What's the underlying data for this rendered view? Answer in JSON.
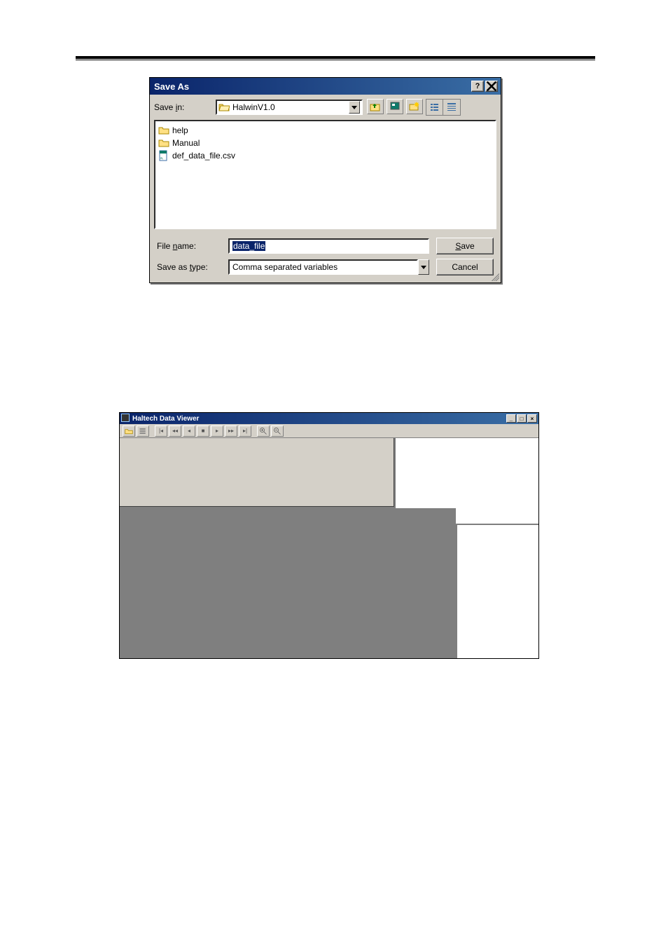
{
  "saveas": {
    "title": "Save As",
    "save_in_label_prefix": "Save ",
    "save_in_underline": "i",
    "save_in_label_suffix": "n:",
    "current_folder": "HalwinV1.0",
    "files": [
      {
        "type": "folder",
        "name": "help"
      },
      {
        "type": "folder",
        "name": "Manual"
      },
      {
        "type": "csv",
        "name": "def_data_file.csv"
      }
    ],
    "filename_label_prefix": "File ",
    "filename_underline": "n",
    "filename_label_suffix": "ame:",
    "filename_value": "data_file",
    "saveas_type_label_prefix": "Save as ",
    "saveas_type_underline": "t",
    "saveas_type_label_suffix": "ype:",
    "type_value": "Comma separated variables",
    "save_btn_underline": "S",
    "save_btn_suffix": "ave",
    "cancel_btn": "Cancel"
  },
  "viewer": {
    "title": "Haltech Data Viewer"
  }
}
